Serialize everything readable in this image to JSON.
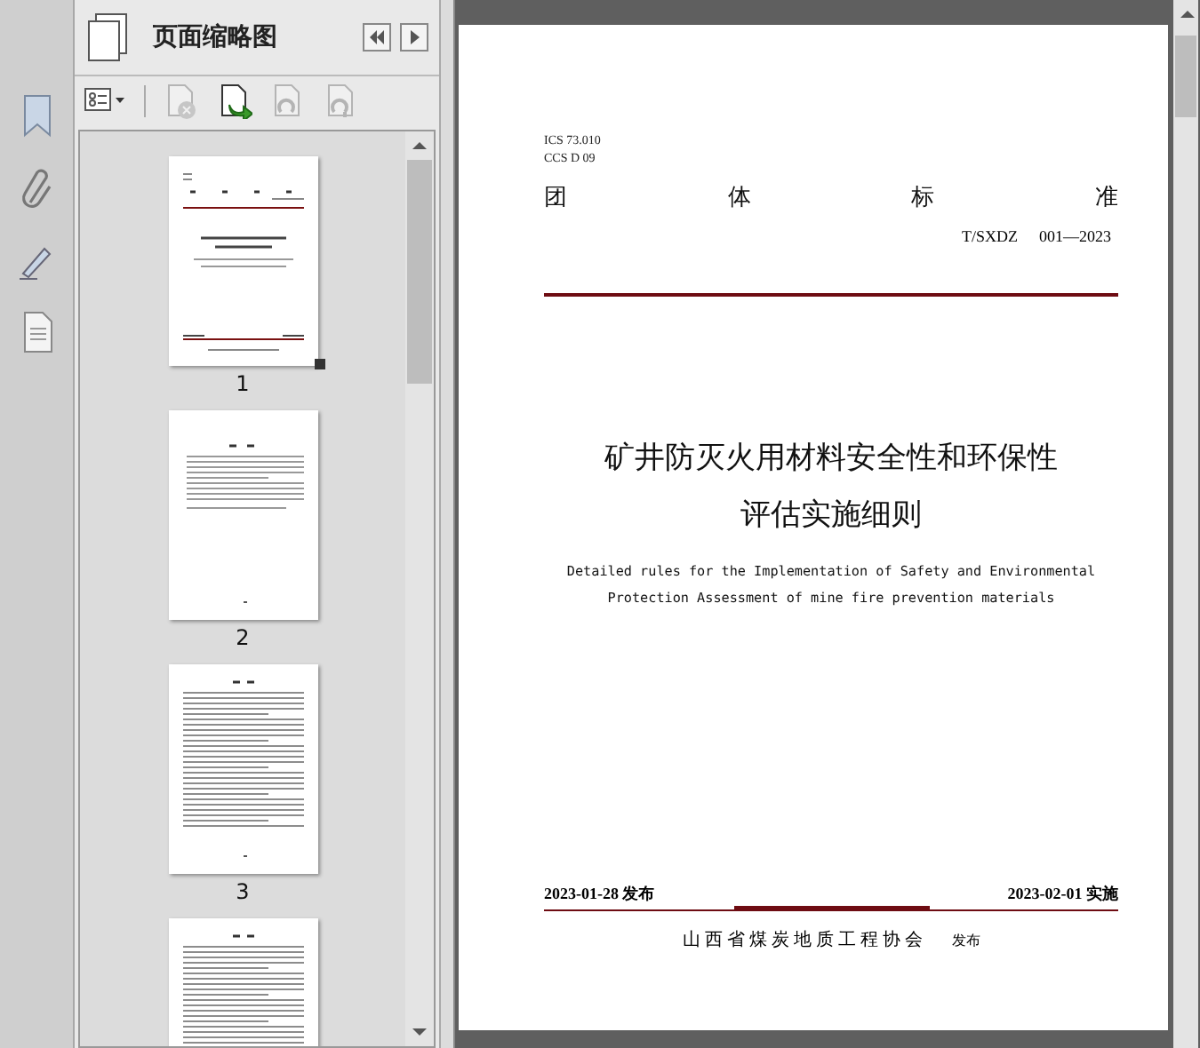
{
  "panel": {
    "title": "页面缩略图",
    "toolbar": [
      {
        "kind": "options",
        "disabled": false
      },
      {
        "kind": "delete",
        "disabled": true
      },
      {
        "kind": "insert",
        "disabled": false
      },
      {
        "kind": "undo",
        "disabled": true
      },
      {
        "kind": "redo",
        "disabled": true
      }
    ],
    "thumbnails": [
      {
        "kind": "cover",
        "label": "1",
        "selected": true
      },
      {
        "kind": "contents",
        "label": "2",
        "selected": false
      },
      {
        "kind": "text",
        "label": "3",
        "selected": false
      },
      {
        "kind": "text",
        "selected": false
      }
    ]
  },
  "document": {
    "ics": "ICS 73.010",
    "ccs": "CCS D 09",
    "standard_type": [
      "团",
      "体",
      "标",
      "准"
    ],
    "code": [
      "T/SXDZ",
      "001—2023"
    ],
    "title_lines": [
      "矿井防灭火用材料安全性和环保性",
      "评估实施细则"
    ],
    "english_lines": [
      "Detailed rules for the Implementation of Safety and Environmental",
      "Protection Assessment of mine fire prevention materials"
    ],
    "issue_date": "2023-01-28 发布",
    "effective_date": "2023-02-01 实施",
    "publisher": "山西省煤炭地质工程协会",
    "publisher_suffix": "发布"
  }
}
